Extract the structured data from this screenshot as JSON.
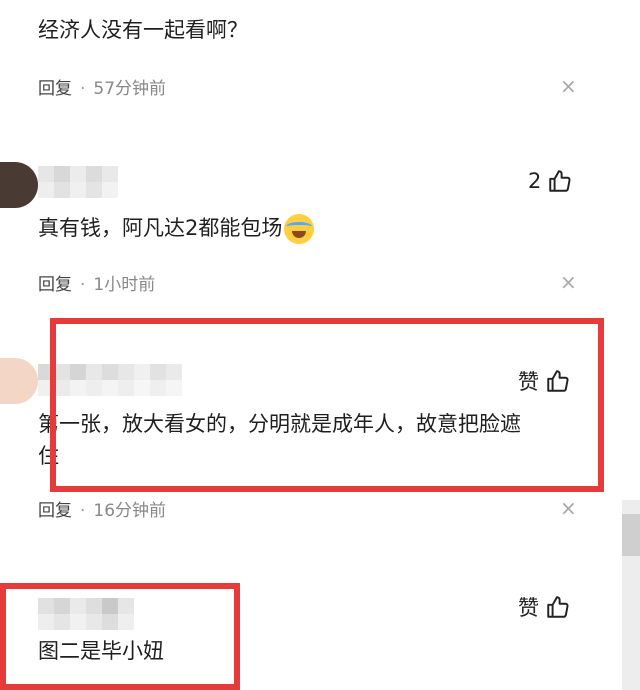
{
  "comments": [
    {
      "text": "经济人没有一起看啊？",
      "reply_label": "回复",
      "separator": "·",
      "time": "57分钟前",
      "close_glyph": "×"
    },
    {
      "like_count": "2",
      "text": "真有钱，阿凡达2都能包场",
      "reply_label": "回复",
      "separator": "·",
      "time": "1小时前",
      "close_glyph": "×"
    },
    {
      "like_label": "赞",
      "text_line1": "第一张，放大看女的，分明就是成年人，故意把脸遮",
      "text_line2": "住",
      "reply_label": "回复",
      "separator": "·",
      "time": "16分钟前",
      "close_glyph": "×"
    },
    {
      "like_label": "赞",
      "text": "图二是毕小妞"
    }
  ],
  "colors": {
    "highlight_border": "#e53b3b",
    "secondary_text": "#888888"
  },
  "icons": {
    "like": "thumbs-up-icon",
    "close": "close-icon",
    "emoji": "laughing-crying-emoji-icon"
  }
}
